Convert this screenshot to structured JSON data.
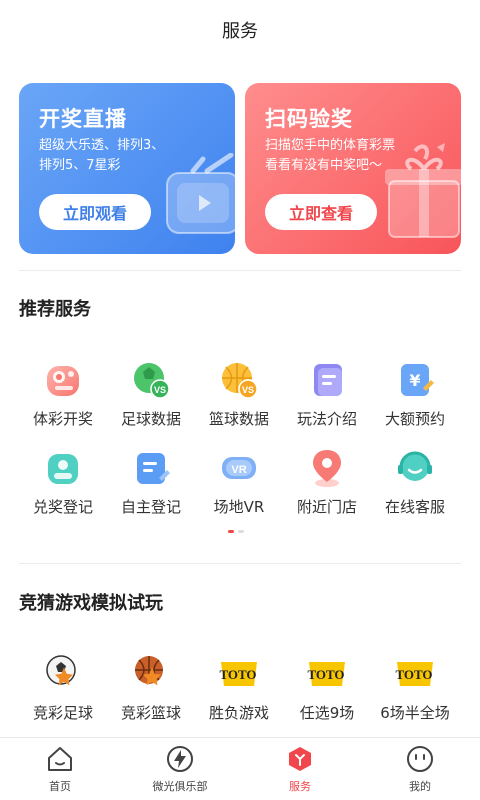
{
  "header": {
    "title": "服务"
  },
  "banners": {
    "live": {
      "title": "开奖直播",
      "desc_line1": "超级大乐透、排列3、",
      "desc_line2": "排列5、7星彩",
      "button": "立即观看"
    },
    "scan": {
      "title": "扫码验奖",
      "desc_line1": "扫描您手中的体育彩票",
      "desc_line2": "看看有没有中奖吧～",
      "button": "立即查看"
    }
  },
  "recommended": {
    "title": "推荐服务",
    "items": [
      {
        "label": "体彩开奖",
        "icon": "lottery-draw-icon"
      },
      {
        "label": "足球数据",
        "icon": "football-vs-icon"
      },
      {
        "label": "篮球数据",
        "icon": "basketball-vs-icon"
      },
      {
        "label": "玩法介绍",
        "icon": "rules-doc-icon"
      },
      {
        "label": "大额预约",
        "icon": "yuan-booking-icon"
      },
      {
        "label": "兑奖登记",
        "icon": "redeem-register-icon"
      },
      {
        "label": "自主登记",
        "icon": "self-register-icon"
      },
      {
        "label": "场地VR",
        "icon": "vr-icon"
      },
      {
        "label": "附近门店",
        "icon": "location-pin-icon"
      },
      {
        "label": "在线客服",
        "icon": "customer-service-icon"
      }
    ]
  },
  "games": {
    "title": "竞猜游戏模拟试玩",
    "items": [
      {
        "label": "竞彩足球",
        "icon": "soccer-ball-icon"
      },
      {
        "label": "竞彩篮球",
        "icon": "basketball-icon"
      },
      {
        "label": "胜负游戏",
        "icon": "toto-logo-icon"
      },
      {
        "label": "任选9场",
        "icon": "toto-logo-icon"
      },
      {
        "label": "6场半全场",
        "icon": "toto-logo-icon"
      }
    ]
  },
  "tabbar": {
    "items": [
      {
        "label": "首页",
        "icon": "home-icon"
      },
      {
        "label": "微光俱乐部",
        "icon": "lightning-icon"
      },
      {
        "label": "服务",
        "icon": "service-cube-icon",
        "active": true
      },
      {
        "label": "我的",
        "icon": "profile-face-icon"
      }
    ]
  },
  "colors": {
    "accent": "#f0464c",
    "blue_banner": "#3f82ef",
    "red_banner": "#f8555a"
  }
}
